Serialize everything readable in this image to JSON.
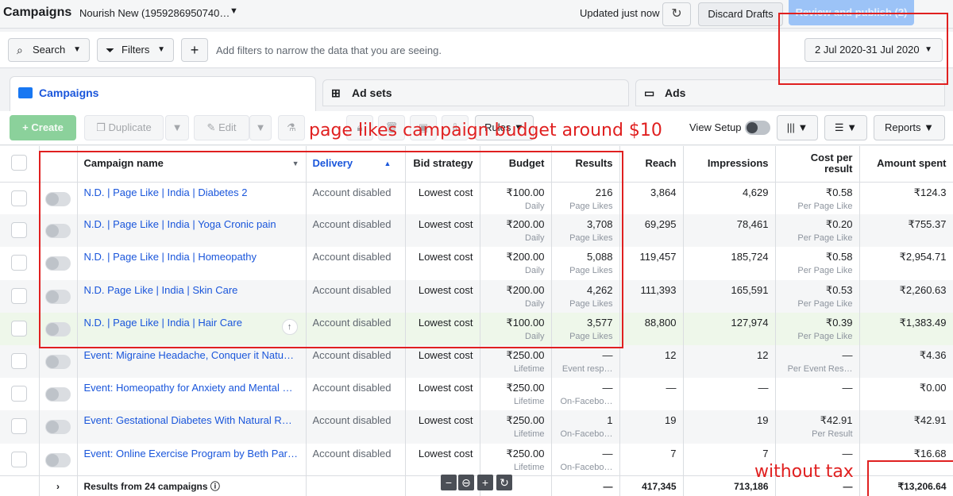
{
  "topbar": {
    "title": "Campaigns",
    "account": "Nourish New (1959286950740…",
    "updated": "Updated just now",
    "discard": "Discard Drafts",
    "review": "Review and publish (2)"
  },
  "filterbar": {
    "search": "Search",
    "filters": "Filters",
    "hint": "Add filters to narrow the data that you are seeing.",
    "date_range": "2 Jul 2020-31 Jul 2020"
  },
  "tabs": [
    {
      "label": "Campaigns"
    },
    {
      "label": "Ad sets"
    },
    {
      "label": "Ads"
    }
  ],
  "toolbar": {
    "create": "Create",
    "duplicate": "Duplicate",
    "edit": "Edit",
    "rules": "Rules",
    "view_setup": "View Setup",
    "reports": "Reports"
  },
  "columns": {
    "name": "Campaign name",
    "delivery": "Delivery",
    "bid": "Bid strategy",
    "budget": "Budget",
    "results": "Results",
    "reach": "Reach",
    "impressions": "Impressions",
    "cpr": "Cost per result",
    "spent": "Amount spent"
  },
  "rows": [
    {
      "name": "N.D. | Page Like | India | Diabetes 2",
      "delivery": "Account disabled",
      "bid": "Lowest cost",
      "budget": "₹100.00",
      "budget_type": "Daily",
      "results": "216",
      "results_type": "Page Likes",
      "reach": "3,864",
      "impressions": "4,629",
      "cpr": "₹0.58",
      "cpr_type": "Per Page Like",
      "spent": "₹124.3"
    },
    {
      "name": "N.D. | Page Like | India | Yoga Cronic pain",
      "delivery": "Account disabled",
      "bid": "Lowest cost",
      "budget": "₹200.00",
      "budget_type": "Daily",
      "results": "3,708",
      "results_type": "Page Likes",
      "reach": "69,295",
      "impressions": "78,461",
      "cpr": "₹0.20",
      "cpr_type": "Per Page Like",
      "spent": "₹755.37"
    },
    {
      "name": "N.D. | Page Like | India | Homeopathy",
      "delivery": "Account disabled",
      "bid": "Lowest cost",
      "budget": "₹200.00",
      "budget_type": "Daily",
      "results": "5,088",
      "results_type": "Page Likes",
      "reach": "119,457",
      "impressions": "185,724",
      "cpr": "₹0.58",
      "cpr_type": "Per Page Like",
      "spent": "₹2,954.71"
    },
    {
      "name": "N.D. Page Like | India | Skin Care",
      "delivery": "Account disabled",
      "bid": "Lowest cost",
      "budget": "₹200.00",
      "budget_type": "Daily",
      "results": "4,262",
      "results_type": "Page Likes",
      "reach": "111,393",
      "impressions": "165,591",
      "cpr": "₹0.53",
      "cpr_type": "Per Page Like",
      "spent": "₹2,260.63"
    },
    {
      "name": "N.D. | Page Like | India | Hair Care",
      "delivery": "Account disabled",
      "bid": "Lowest cost",
      "budget": "₹100.00",
      "budget_type": "Daily",
      "results": "3,577",
      "results_type": "Page Likes",
      "reach": "88,800",
      "impressions": "127,974",
      "cpr": "₹0.39",
      "cpr_type": "Per Page Like",
      "spent": "₹1,383.49"
    },
    {
      "name": "Event: Migraine Headache, Conquer it Natu…",
      "delivery": "Account disabled",
      "bid": "Lowest cost",
      "budget": "₹250.00",
      "budget_type": "Lifetime",
      "results": "—",
      "results_type": "Event resp…",
      "reach": "12",
      "impressions": "12",
      "cpr": "—",
      "cpr_type": "Per Event Res…",
      "spent": "₹4.36"
    },
    {
      "name": "Event: Homeopathy for Anxiety and Mental …",
      "delivery": "Account disabled",
      "bid": "Lowest cost",
      "budget": "₹250.00",
      "budget_type": "Lifetime",
      "results": "—",
      "results_type": "On-Facebo…",
      "reach": "—",
      "impressions": "—",
      "cpr": "—",
      "cpr_type": "",
      "spent": "₹0.00"
    },
    {
      "name": "Event: Gestational Diabetes With Natural R…",
      "delivery": "Account disabled",
      "bid": "Lowest cost",
      "budget": "₹250.00",
      "budget_type": "Lifetime",
      "results": "1",
      "results_type": "On-Facebo…",
      "reach": "19",
      "impressions": "19",
      "cpr": "₹42.91",
      "cpr_type": "Per Result",
      "spent": "₹42.91"
    },
    {
      "name": "Event: Online Exercise Program by Beth Par…",
      "delivery": "Account disabled",
      "bid": "Lowest cost",
      "budget": "₹250.00",
      "budget_type": "Lifetime",
      "results": "—",
      "results_type": "On-Facebo…",
      "reach": "7",
      "impressions": "7",
      "cpr": "—",
      "cpr_type": "",
      "spent": "₹16.68"
    }
  ],
  "totals": {
    "label": "Results from 24 campaigns",
    "results": "—",
    "reach": "417,345",
    "impressions": "713,186",
    "cpr": "—",
    "spent": "₹13,206.64"
  },
  "annotations": {
    "budget_note": "page likes campaign budget around $10",
    "tax_note": "without tax",
    "color": "#e02020"
  }
}
